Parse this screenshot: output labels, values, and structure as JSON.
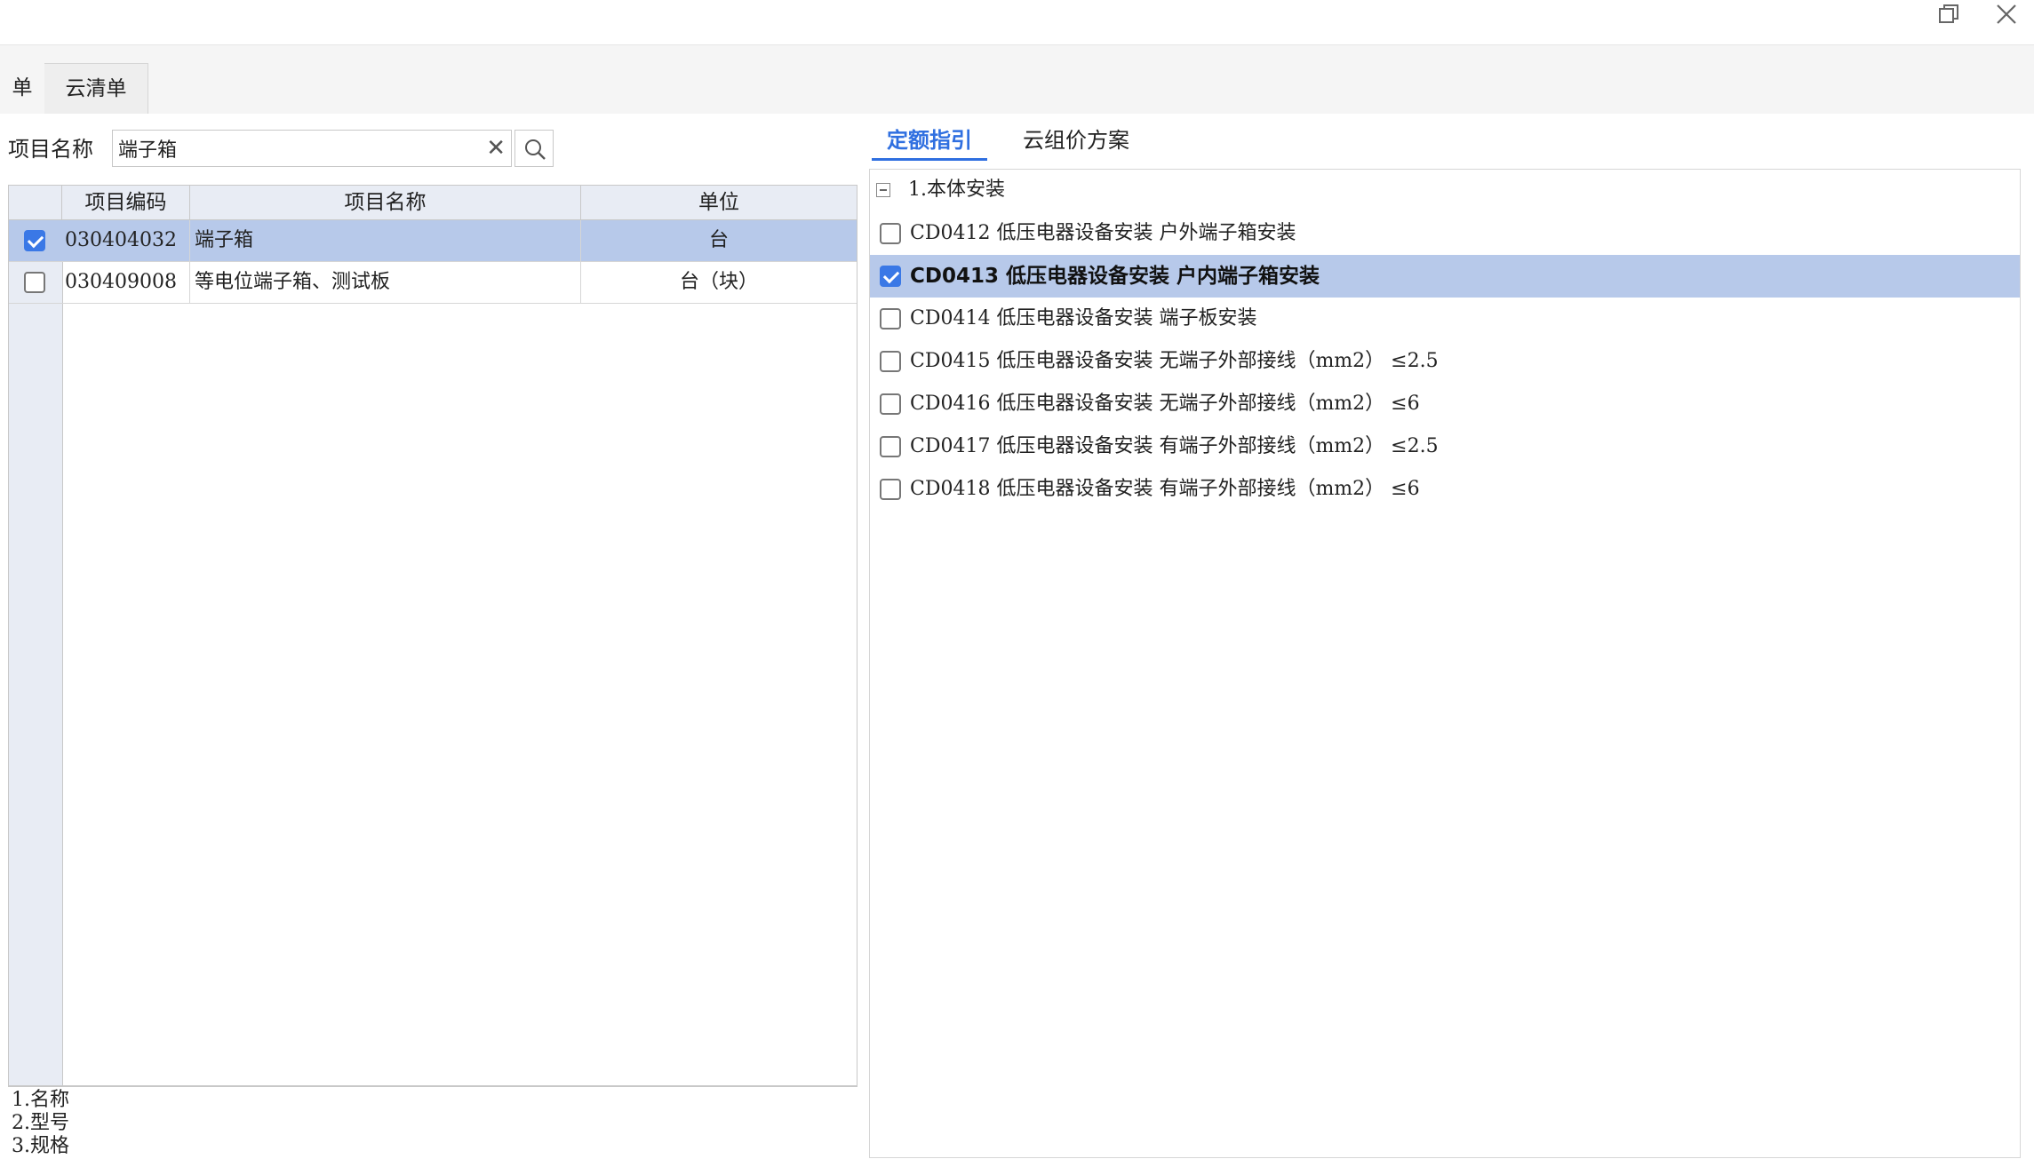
{
  "window": {
    "restore_icon": "restore-icon",
    "close_icon": "close-icon"
  },
  "top_tabs": [
    {
      "label": "单"
    },
    {
      "label": "云清单"
    }
  ],
  "left": {
    "search_label": "项目名称",
    "search_value": "端子箱",
    "search_placeholder": "",
    "table": {
      "headers": {
        "code": "项目编码",
        "name": "项目名称",
        "unit": "单位"
      },
      "rows": [
        {
          "checked": true,
          "code": "030404032",
          "name": "端子箱",
          "unit": "台"
        },
        {
          "checked": false,
          "code": "030409008",
          "name": "等电位端子箱、测试板",
          "unit": "台（块）"
        }
      ]
    },
    "notes": [
      "1.名称",
      "2.型号",
      "3.规格"
    ]
  },
  "right": {
    "tabs": [
      {
        "label": "定额指引",
        "active": true
      },
      {
        "label": "云组价方案",
        "active": false
      }
    ],
    "tree_header": "1.本体安装",
    "items": [
      {
        "checked": false,
        "label": "CD0412 低压电器设备安装 户外端子箱安装"
      },
      {
        "checked": true,
        "label": "CD0413 低压电器设备安装 户内端子箱安装"
      },
      {
        "checked": false,
        "label": "CD0414 低压电器设备安装 端子板安装"
      },
      {
        "checked": false,
        "label": "CD0415 低压电器设备安装 无端子外部接线（mm2） ≤2.5"
      },
      {
        "checked": false,
        "label": "CD0416 低压电器设备安装 无端子外部接线（mm2） ≤6"
      },
      {
        "checked": false,
        "label": "CD0417 低压电器设备安装 有端子外部接线（mm2） ≤2.5"
      },
      {
        "checked": false,
        "label": "CD0418 低压电器设备安装 有端子外部接线（mm2） ≤6"
      }
    ]
  },
  "colors": {
    "accent": "#2f6fe0",
    "selection": "#b7c9ea",
    "checkbox": "#3a78e6"
  }
}
